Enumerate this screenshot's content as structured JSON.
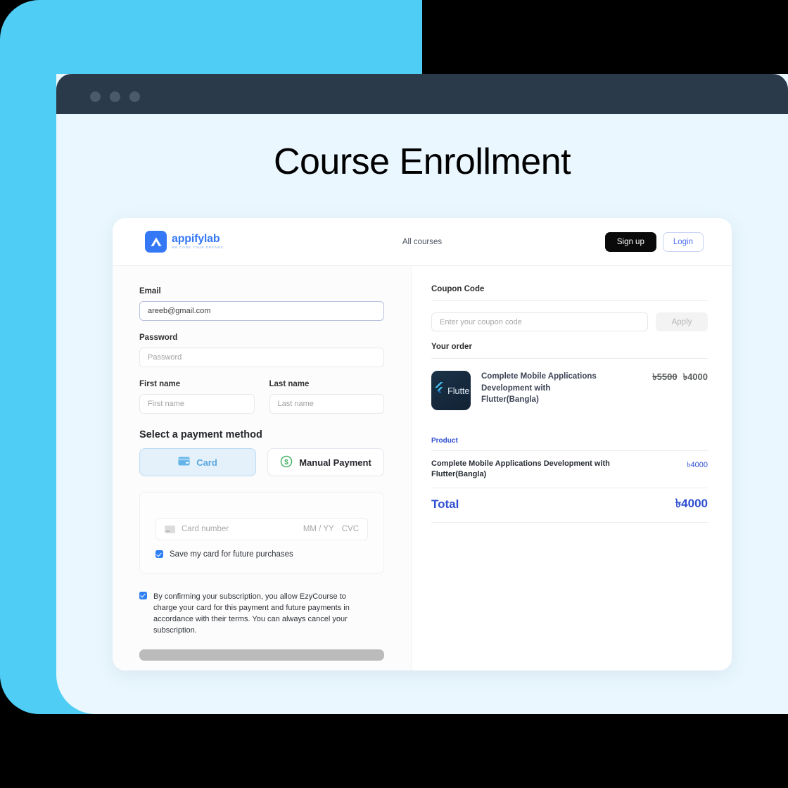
{
  "hero": {
    "title": "Course Enrollment"
  },
  "chrome": {
    "dots": [
      "dot-1",
      "dot-2",
      "dot-3"
    ]
  },
  "header": {
    "brand_name": "appifylab",
    "brand_tagline": "WE CODE YOUR DREAMS",
    "nav_link": "All courses",
    "signup_label": "Sign up",
    "login_label": "Login"
  },
  "form": {
    "email_label": "Email",
    "email_value": "areeb@gmail.com",
    "password_label": "Password",
    "password_placeholder": "Password",
    "first_name_label": "First name",
    "first_name_placeholder": "First name",
    "last_name_label": "Last name",
    "last_name_placeholder": "Last name",
    "payment_section_title": "Select a payment method",
    "method_card": "Card",
    "method_manual": "Manual Payment",
    "card_number_placeholder": "Card number",
    "card_expiry_placeholder": "MM / YY",
    "card_cvc_placeholder": "CVC",
    "save_card_label": "Save my card for future purchases",
    "terms_text": "By confirming your subscription, you allow EzyCourse to charge your card for this payment and future payments in accordance with their terms. You can always cancel your subscription."
  },
  "order": {
    "coupon_label": "Coupon Code",
    "coupon_placeholder": "Enter your coupon code",
    "apply_label": "Apply",
    "your_order_label": "Your order",
    "item_thumb_label": "Flutte",
    "item_title": "Complete Mobile Applications Development with Flutter(Bangla)",
    "price_old": "৳5500",
    "price_new": "৳4000",
    "summary_col_label": "Product",
    "summary_item_name": "Complete Mobile Applications Development with Flutter(Bangla)",
    "summary_item_price": "৳4000",
    "total_label": "Total",
    "total_value": "৳4000"
  },
  "colors": {
    "cyan_panel": "#4fcdf5",
    "light_sheet": "#eaf7fe",
    "chrome_bar": "#2b3a4a",
    "brand_blue": "#3478f6",
    "accent_blue": "#2f4fd0",
    "card_selected_bg": "#e4f1fb",
    "manual_green": "#3fae5e",
    "checkbox_blue": "#2f7ff3"
  }
}
